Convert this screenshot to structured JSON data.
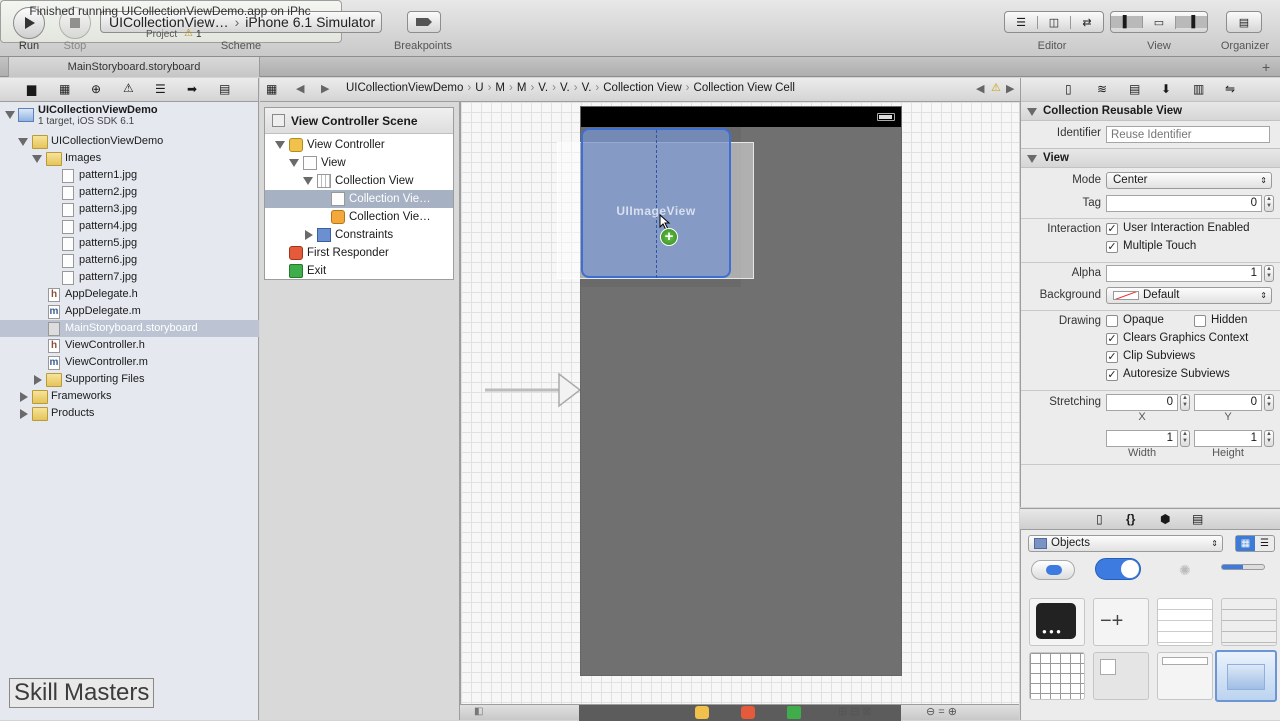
{
  "toolbar": {
    "run": "Run",
    "stop": "Stop",
    "scheme_target": "UICollectionView…",
    "scheme_device": "iPhone 6.1 Simulator",
    "scheme_label": "Scheme",
    "breakpoints": "Breakpoints",
    "status": "Finished running UICollectionViewDemo.app on iPhc",
    "project_label": "Project",
    "warning_count": "1",
    "editor": "Editor",
    "view": "View",
    "organizer": "Organizer"
  },
  "tab": {
    "label": "MainStoryboard.storyboard"
  },
  "jumpbar": {
    "items": [
      "UICollectionViewDemo",
      "U",
      "M",
      "M",
      "V.",
      "V.",
      "V.",
      "Collection View",
      "Collection View Cell"
    ]
  },
  "navigator": {
    "project_name": "UICollectionViewDemo",
    "project_sub": "1 target, iOS SDK 6.1",
    "group": "UICollectionViewDemo",
    "images_group": "Images",
    "images": [
      "pattern1.jpg",
      "pattern2.jpg",
      "pattern3.jpg",
      "pattern4.jpg",
      "pattern5.jpg",
      "pattern6.jpg",
      "pattern7.jpg"
    ],
    "files": [
      "AppDelegate.h",
      "AppDelegate.m",
      "MainStoryboard.storyboard",
      "ViewController.h",
      "ViewController.m"
    ],
    "supporting": "Supporting Files",
    "frameworks": "Frameworks",
    "products": "Products"
  },
  "outline": {
    "title": "View Controller Scene",
    "items": [
      "View Controller",
      "View",
      "Collection View",
      "Collection Vie…",
      "Collection Vie…",
      "Constraints",
      "First Responder",
      "Exit"
    ]
  },
  "canvas": {
    "drag_label": "UIImageView"
  },
  "inspector": {
    "sect_reusable": "Collection Reusable View",
    "identifier_label": "Identifier",
    "identifier_placeholder": "Reuse Identifier",
    "sect_view": "View",
    "mode_label": "Mode",
    "mode_value": "Center",
    "tag_label": "Tag",
    "tag_value": "0",
    "interaction_label": "Interaction",
    "user_interaction": "User Interaction Enabled",
    "multiple_touch": "Multiple Touch",
    "alpha_label": "Alpha",
    "alpha_value": "1",
    "background_label": "Background",
    "background_value": "Default",
    "drawing_label": "Drawing",
    "opaque": "Opaque",
    "hidden": "Hidden",
    "clears": "Clears Graphics Context",
    "clip": "Clip Subviews",
    "autoresize": "Autoresize Subviews",
    "stretching_label": "Stretching",
    "stretch_x": "0",
    "stretch_y": "0",
    "stretch_w": "1",
    "stretch_h": "1",
    "x_label": "X",
    "y_label": "Y",
    "width_label": "Width",
    "height_label": "Height"
  },
  "library": {
    "filter": "Objects"
  },
  "watermark": {
    "skill": "Skill",
    "masters": "Masters"
  }
}
